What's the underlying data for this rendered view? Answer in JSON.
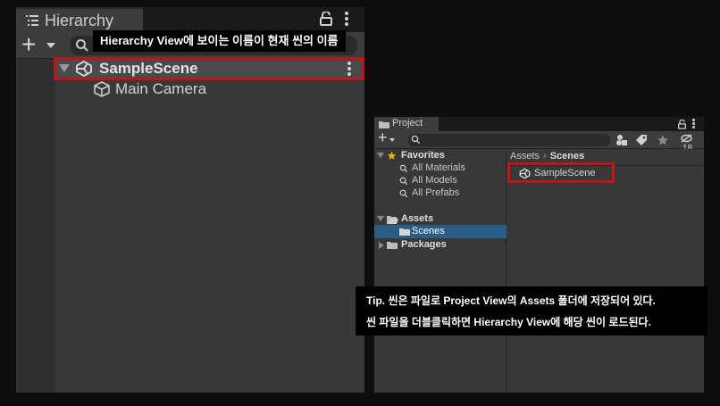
{
  "hierarchy": {
    "tab_title": "Hierarchy",
    "tab_icon": "list-icon",
    "scene_name": "SampleScene",
    "child_object": "Main Camera"
  },
  "caption_top": "Hierarchy View에 보이는 이름이 현재 씬의 이름",
  "project": {
    "tab_title": "Project",
    "hidden_count": "18",
    "favorites": {
      "label": "Favorites",
      "items": [
        "All Materials",
        "All Models",
        "All Prefabs"
      ]
    },
    "assets": {
      "label": "Assets",
      "children": [
        "Scenes"
      ]
    },
    "packages": {
      "label": "Packages"
    },
    "breadcrumb": {
      "root": "Assets",
      "current": "Scenes"
    },
    "scene_asset": "SampleScene"
  },
  "caption_bottom": {
    "line1": "Tip. 씬은 파일로 Project View의 Assets 폴더에 저장되어 있다.",
    "line2": "씬 파일을 더블클릭하면 Hierarchy View에 해당 씬이 로드된다."
  },
  "colors": {
    "highlight": "#c0141b",
    "selection": "#2c5d87",
    "favorites_star": "#f0b400",
    "caption_bg": "#000000"
  }
}
